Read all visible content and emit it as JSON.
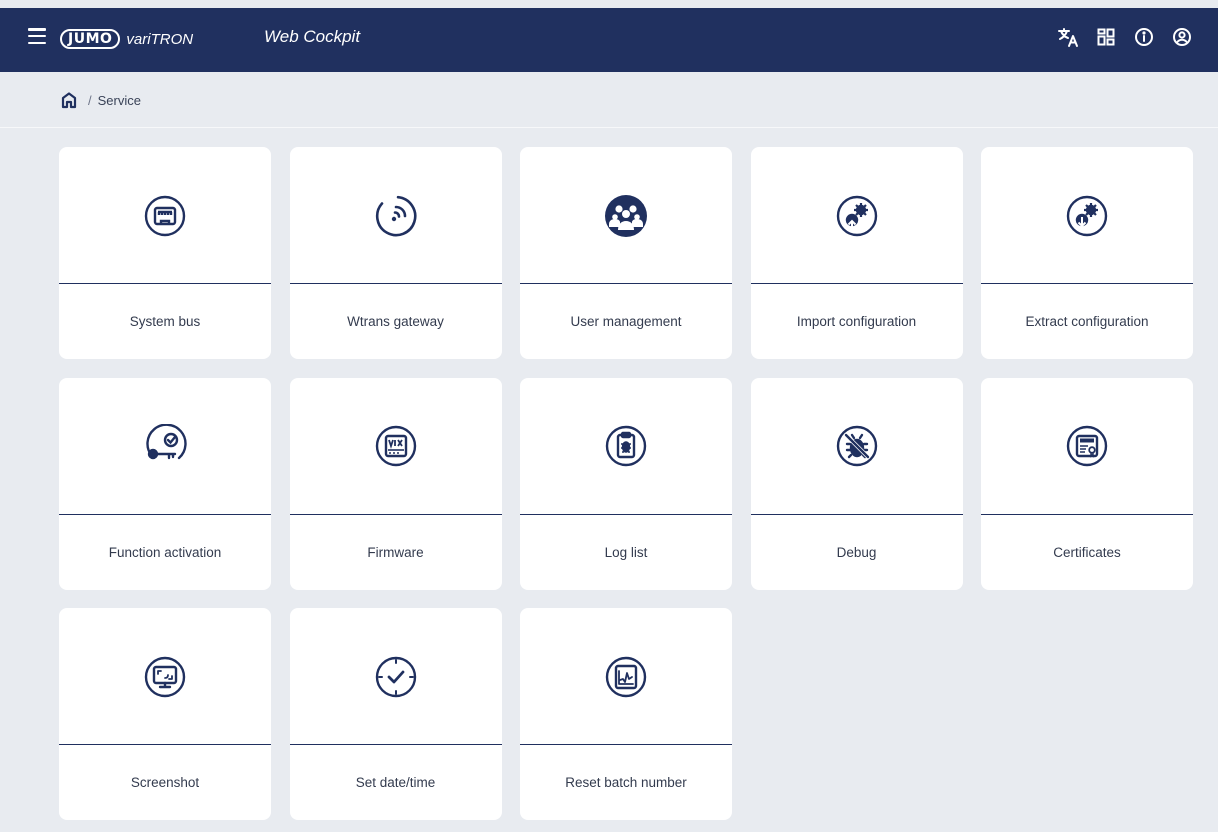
{
  "header": {
    "logo_badge": "JUMO",
    "logo_product": "variTRON",
    "app_title": "Web Cockpit",
    "icons": [
      "translate-icon",
      "dashboard-icon",
      "info-icon",
      "account-icon"
    ]
  },
  "breadcrumb": {
    "separator": "/",
    "current": "Service"
  },
  "colors": {
    "header_bg": "#20305f",
    "page_bg": "#e8ebf0",
    "card_bg": "#ffffff",
    "accent": "#20305f"
  },
  "tiles": [
    {
      "label": "System bus",
      "icon": "ethernet-port-icon"
    },
    {
      "label": "Wtrans gateway",
      "icon": "wireless-gateway-icon"
    },
    {
      "label": "User management",
      "icon": "users-group-icon"
    },
    {
      "label": "Import configuration",
      "icon": "import-config-gears-icon"
    },
    {
      "label": "Extract configuration",
      "icon": "extract-config-gears-icon"
    },
    {
      "label": "Function activation",
      "icon": "key-activation-icon"
    },
    {
      "label": "Firmware",
      "icon": "firmware-v1x-icon"
    },
    {
      "label": "Log list",
      "icon": "log-clipboard-icon"
    },
    {
      "label": "Debug",
      "icon": "debug-bug-icon"
    },
    {
      "label": "Certificates",
      "icon": "certificate-icon"
    },
    {
      "label": "Screenshot",
      "icon": "screenshot-monitor-icon"
    },
    {
      "label": "Set date/time",
      "icon": "clock-check-icon"
    },
    {
      "label": "Reset batch number",
      "icon": "batch-chart-icon"
    }
  ]
}
